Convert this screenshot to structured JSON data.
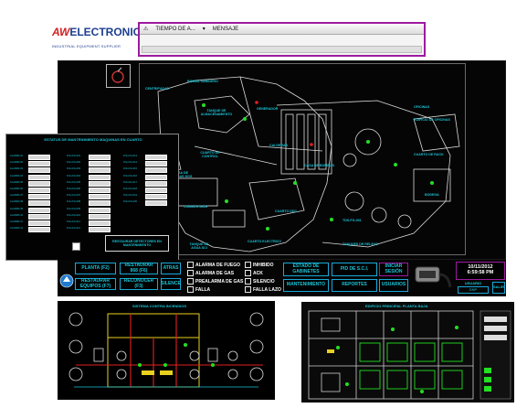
{
  "logo": {
    "brand_prefix": "AW",
    "brand_name": "ELECTRONICA",
    "tagline": "INDUSTRIAL EQUIPMENT SUPPLIER"
  },
  "message_window": {
    "col_time": "TIEMPO DE A...",
    "col_message": "MENSAJE"
  },
  "map_labels": {
    "centrifugas": "CENTRIFUGAS",
    "bomba_sumidero": "BOMBA SUMIDERO",
    "tanque_alm": "TANQUE DE ALMACENAMIENTO",
    "generador": "GENERADOR",
    "calderas": "CALDERAS",
    "cuarto_control": "CUARTO DE CONTROL",
    "casa_bombas_dos": "CASA DE BOMBAS DOS",
    "combustible": "COMBUSTIBLE",
    "tanque_agua_sci": "TANQUE DE AGUA SCI",
    "cuarto_electrico": "CUARTO ELECTRICO",
    "cuarto_ddc": "CUARTO DDC",
    "tds_fg": "TDS-FG-001",
    "tanques_relevo": "TANQUES DE RELEVO",
    "casa_bombas": "CASA DE BOMBAS",
    "oficinas": "OFICINAS",
    "edif_oficinas": "EDIFICIO DE OFICINAS",
    "bodega": "BODEGA",
    "cuarto_rack": "CUARTO DE RACK"
  },
  "maintenance": {
    "title": "ESTATUS DE MANTENIMIENTO MAQUINAS EN CUARTO",
    "left_rows": [
      "ALARMA 01",
      "ALARMA 02",
      "ALARMA 03",
      "ALARMA 04",
      "ALARMA 05",
      "ALARMA 06",
      "ALARMA 07",
      "ALARMA 08",
      "ALARMA 09",
      "ALARMA 10",
      "ALARMA 11",
      "ALARMA 12"
    ],
    "mid_rows": [
      "FCH-FG-001",
      "FCH-FG-002",
      "FCH-FG-003",
      "FCH-FG-004",
      "FCH-FG-005",
      "FCH-FG-006",
      "FCH-FG-007",
      "FCH-FG-008",
      "FCH-FG-009",
      "FCH-FG-010",
      "FCH-FG-011",
      "FCH-FG-012"
    ],
    "right_rows": [
      "FCH-FG-013",
      "FCH-FG-014",
      "FCH-FG-015",
      "FCH-FG-016",
      "FCH-FG-017",
      "FCH-FG-018",
      "FCH-FG-019",
      "FCH-FG-020"
    ],
    "restore_label": "RESTAURAR DETECTORES EN MANTENIMIENTO"
  },
  "nav": {
    "planta": "PLANTA (F2)",
    "restaurar_868": "RESTAURAR 868 (F6)",
    "atras": "ATRAS",
    "restaurar_equipos": "RESTAURAR EQUIPOS (F7)",
    "reconocer": "RECONOCER (F3)",
    "silence": "SILENCE",
    "estado_gabinetes": "ESTADO DE GABINETES",
    "pid_sci": "PID DE S.C.I.",
    "iniciar_sesion": "INICIAR SESIÓN",
    "mantenimiento": "MANTENIMIENTO",
    "reportes": "REPORTES",
    "usuarios": "USUARIOS",
    "usuario_label": "USUARIO",
    "usuario_value": "DNP",
    "salir": "SALIR"
  },
  "legend": {
    "alarma_fuego": "ALARMA DE FUEGO",
    "alarma_gas": "ALARMA DE GAS",
    "prealarma_gas": "PREALARMA DE GAS",
    "falla": "FALLA",
    "inhibido": "INHIBIDO",
    "ack": "ACK",
    "silencio": "SILENCIO",
    "falla_lazo": "FALLA LAZO"
  },
  "clock": {
    "date": "10/11/2012",
    "time": "6:59:58 PM"
  },
  "thumb1": {
    "title": "SISTEMA CONTRA INCENDIOS"
  },
  "thumb2": {
    "title": "EDIFICIO PRINCIPAL PLANTA BAJA"
  },
  "colors": {
    "accent_cyan": "#19c3d6",
    "frame_magenta": "#9c1aa0",
    "alarm_green": "#22e022",
    "alarm_red": "#e02020",
    "alarm_yellow": "#e8d020"
  }
}
